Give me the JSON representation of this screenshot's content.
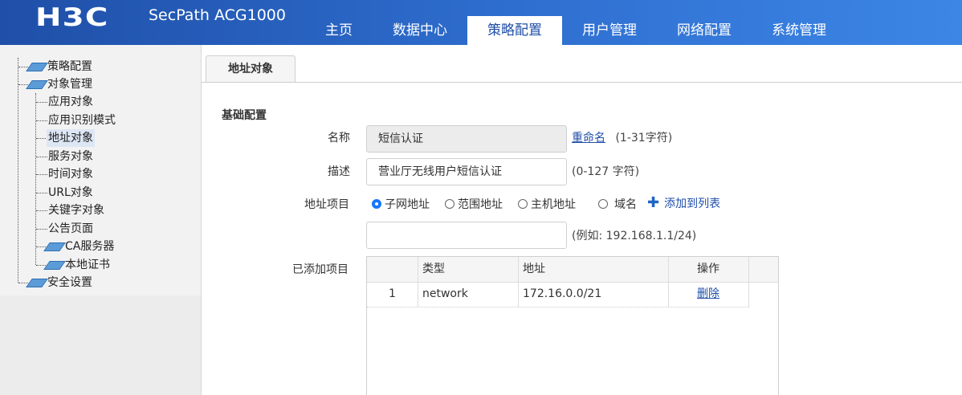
{
  "header": {
    "logo": "H3C",
    "product": "SecPath ACG1000",
    "nav": [
      "主页",
      "数据中心",
      "策略配置",
      "用户管理",
      "网络配置",
      "系统管理"
    ],
    "active_index": 2
  },
  "tree": {
    "policy_config": "策略配置",
    "object_mgmt": "对象管理",
    "items": [
      "应用对象",
      "应用识别模式",
      "地址对象",
      "服务对象",
      "时间对象",
      "URL对象",
      "关键字对象",
      "公告页面"
    ],
    "ca_server": "CA服务器",
    "local_cert": "本地证书",
    "security": "安全设置"
  },
  "tab": {
    "label": "地址对象"
  },
  "form": {
    "section": "基础配置",
    "name_label": "名称",
    "name_value": "短信认证",
    "rename_link": "重命名",
    "name_hint": "(1-31字符)",
    "desc_label": "描述",
    "desc_value": "营业厅无线用户短信认证",
    "desc_hint": "(0-127 字符)",
    "addr_label": "地址项目",
    "radio_subnet": "子网地址",
    "radio_range": "范围地址",
    "radio_host": "主机地址",
    "radio_domain": "域名",
    "add_to_list": "添加到列表",
    "addr_input": "",
    "addr_hint": "(例如:  192.168.1.1/24)",
    "added_label": "已添加项目"
  },
  "table": {
    "columns": [
      "",
      "类型",
      "地址",
      "操作"
    ],
    "rows": [
      {
        "index": "1",
        "type": "network",
        "address": "172.16.0.0/21",
        "action": "删除"
      }
    ]
  },
  "colors": {
    "header": "#1f4fa8",
    "accent": "#1677ff"
  }
}
